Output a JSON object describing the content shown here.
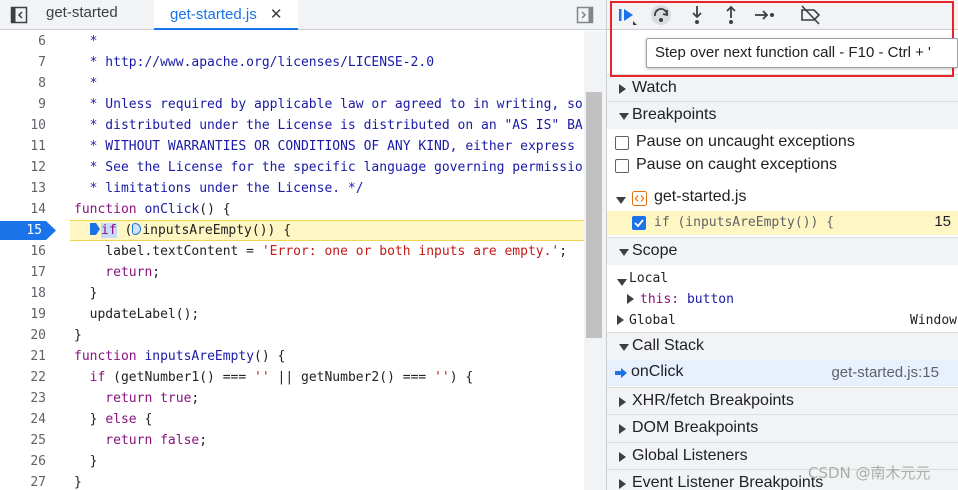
{
  "editor": {
    "tabs": [
      {
        "label": "get-started",
        "active": false
      },
      {
        "label": "get-started.js",
        "active": true
      }
    ],
    "close_glyph": "✕",
    "lines": [
      {
        "n": "6",
        "parts": [
          [
            "cmt",
            "  *"
          ]
        ]
      },
      {
        "n": "7",
        "parts": [
          [
            "cmt",
            "  * http://www.apache.org/licenses/LICENSE-2.0"
          ]
        ]
      },
      {
        "n": "8",
        "parts": [
          [
            "cmt",
            "  *"
          ]
        ]
      },
      {
        "n": "9",
        "parts": [
          [
            "cmt",
            "  * Unless required by applicable law or agreed to in writing, so"
          ]
        ]
      },
      {
        "n": "10",
        "parts": [
          [
            "cmt",
            "  * distributed under the License is distributed on an \"AS IS\" BA"
          ]
        ]
      },
      {
        "n": "11",
        "parts": [
          [
            "cmt",
            "  * WITHOUT WARRANTIES OR CONDITIONS OF ANY KIND, either express"
          ]
        ]
      },
      {
        "n": "12",
        "parts": [
          [
            "cmt",
            "  * See the License for the specific language governing permissio"
          ]
        ]
      },
      {
        "n": "13",
        "parts": [
          [
            "cmt",
            "  * limitations under the License. */"
          ]
        ]
      },
      {
        "n": "14",
        "parts": [
          [
            "kw",
            "function "
          ],
          [
            "fn",
            "onClick"
          ],
          [
            "",
            "() {"
          ]
        ]
      },
      {
        "n": "15",
        "highlight": true,
        "parts": [
          [
            "kw",
            "if"
          ],
          [
            "",
            " ("
          ],
          [
            "",
            "inputsAreEmpty()) {"
          ]
        ]
      },
      {
        "n": "16",
        "parts": [
          [
            "",
            "    label.textContent = "
          ],
          [
            "str",
            "'Error: one or both inputs are empty.'"
          ],
          [
            "",
            ";"
          ]
        ]
      },
      {
        "n": "17",
        "parts": [
          [
            "kw",
            "    return"
          ],
          [
            "",
            ";"
          ]
        ]
      },
      {
        "n": "18",
        "parts": [
          [
            "",
            "  }"
          ]
        ]
      },
      {
        "n": "19",
        "parts": [
          [
            "",
            "  updateLabel();"
          ]
        ]
      },
      {
        "n": "20",
        "parts": [
          [
            "",
            "}"
          ]
        ]
      },
      {
        "n": "21",
        "parts": [
          [
            "kw",
            "function "
          ],
          [
            "fn",
            "inputsAreEmpty"
          ],
          [
            "",
            "() {"
          ]
        ]
      },
      {
        "n": "22",
        "parts": [
          [
            "kw",
            "  if"
          ],
          [
            "",
            " (getNumber1() === "
          ],
          [
            "str",
            "''"
          ],
          [
            "",
            " || getNumber2() === "
          ],
          [
            "str",
            "''"
          ],
          [
            "",
            ") {"
          ]
        ]
      },
      {
        "n": "23",
        "parts": [
          [
            "kw",
            "    return "
          ],
          [
            "kw",
            "true"
          ],
          [
            "",
            ";"
          ]
        ]
      },
      {
        "n": "24",
        "parts": [
          [
            "",
            "  } "
          ],
          [
            "kw",
            "else"
          ],
          [
            "",
            " {"
          ]
        ]
      },
      {
        "n": "25",
        "parts": [
          [
            "kw",
            "    return "
          ],
          [
            "kw",
            "false"
          ],
          [
            "",
            ";"
          ]
        ]
      },
      {
        "n": "26",
        "parts": [
          [
            "",
            "  }"
          ]
        ]
      },
      {
        "n": "27",
        "parts": [
          [
            "",
            "}"
          ]
        ]
      }
    ]
  },
  "debugger": {
    "tooltip": "Step over next function call - F10 - Ctrl + '",
    "toolbar": [
      "resume-icon",
      "step-over-icon",
      "step-into-icon",
      "step-out-icon",
      "step-icon",
      "deactivate-breakpoints-icon"
    ],
    "sections": {
      "watch": "Watch",
      "breakpoints": "Breakpoints",
      "scope": "Scope",
      "call_stack": "Call Stack",
      "xhr": "XHR/fetch Breakpoints",
      "dom": "DOM Breakpoints",
      "global_listeners": "Global Listeners",
      "event_listener": "Event Listener Breakpoints"
    },
    "pause_uncaught": "Pause on uncaught exceptions",
    "pause_caught": "Pause on caught exceptions",
    "bp_file": "get-started.js",
    "bp_code": "if (inputsAreEmpty()) {",
    "bp_line": "15",
    "scope": {
      "local": "Local",
      "this_key": "this:",
      "this_val": "button",
      "global": "Global",
      "global_val": "Window"
    },
    "call_stack": {
      "fn": "onClick",
      "loc": "get-started.js:15"
    }
  },
  "watermark": "CSDN @南木元元",
  "colors": {
    "accent": "#1a73e8",
    "highlight_box": "#e8242b",
    "breakpoint_marker": "#1a73e8"
  }
}
